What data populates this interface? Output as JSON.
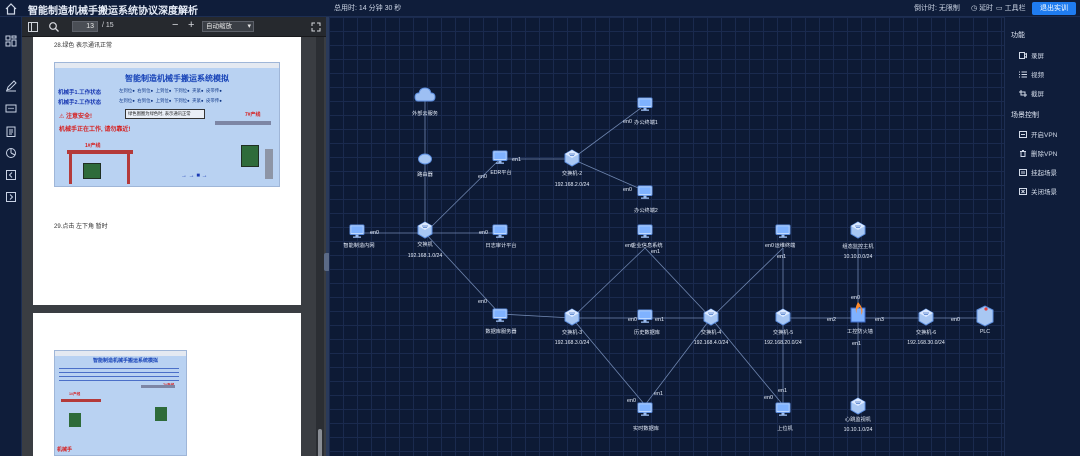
{
  "app": {
    "title": "智能制造机械手搬运系统协议深度解析",
    "total_time": "总用时: 14 分钟 30 秒",
    "countdown": "倒计时: 无限制",
    "delay_label": "延时",
    "toolbar_label": "工具栏",
    "exit_label": "退出实训"
  },
  "rail": {
    "icons": [
      "grid-icon",
      "edit-icon",
      "chat-icon",
      "clipboard-icon",
      "chart-icon",
      "back-icon",
      "exit-icon"
    ]
  },
  "viewer": {
    "page_current": "13",
    "page_total": "/ 15",
    "zoom_out": "−",
    "zoom_in": "+",
    "zoom_mode": "自动缩放",
    "page1": {
      "caption_top": "28.绿色 表示通讯正常",
      "caption_bottom": "29.点击 左下角 暂时",
      "shot": {
        "title": "智能制造机械手搬运系统模拟",
        "row1": "机械手1.工作状态",
        "row2": "机械手2.工作状态",
        "row1_items": [
          "左到位",
          "右到位",
          "上到位",
          "下到位",
          "夹紧",
          "皮带传"
        ],
        "row2_items": [
          "左到位",
          "右到位",
          "上到位",
          "下到位",
          "夹紧",
          "皮带传"
        ],
        "safety": "注意安全!",
        "working": "机械手正在工作, 请勿靠近!",
        "status_hint": "绿色图圈为绿色时, 表示通讯正常",
        "line1": "1#产线",
        "line2": "7#产线"
      }
    },
    "page2": {
      "shot": {
        "title": "智能制造机械手搬运系统模拟",
        "line1": "1#产线",
        "line2": "7#产线",
        "bottom": "机械手"
      }
    }
  },
  "network": {
    "nodes": {
      "cloud": "外部云服务",
      "router": "路由器",
      "mfg_net": "智能制造内网",
      "switch1": "交换机",
      "switch1_ip": "192.168.1.0/24",
      "edr": "EDR平台",
      "log_audit": "日志审计平台",
      "switch2": "交换机-2",
      "switch2_ip": "192.168.2.0/24",
      "office1": "办公终端1",
      "office2": "办公终端2",
      "enterprise": "企业信息系统",
      "ops": "运维终端",
      "scada": "组态监控主机",
      "scada_ip": "10.10.0.0/24",
      "db_server": "数据库服务器",
      "switch3": "交换机-3",
      "switch3_ip": "192.168.3.0/24",
      "hist_db": "历史数据库",
      "switch4": "交换机-4",
      "switch4_ip": "192.168.4.0/24",
      "switch5": "交换机-5",
      "switch5_ip": "192.168.20.0/24",
      "firewall": "工控防火墙",
      "switch6": "交换机-6",
      "switch6_ip": "192.168.30.0/24",
      "plc": "PLC",
      "realtime_db": "实时数据库",
      "upper": "上位机",
      "hmi": "心跳监视机",
      "hmi_ip": "10.10.1.0/24"
    },
    "ports": {
      "p_mfg": "en0",
      "p_edr_a": "en0",
      "p_edr_b": "en1",
      "p_log": "en0",
      "p_off1": "en0",
      "p_off2": "en0",
      "p_ent_a": "en0",
      "p_ent_b": "en1",
      "p_ops_a": "en0",
      "p_ops_b": "en1",
      "p_db": "en0",
      "p_hist_a": "en0",
      "p_hist_b": "en1",
      "p_fw_top": "en0",
      "p_fw_left": "en2",
      "p_fw_right": "en3",
      "p_fw_bottom": "en1",
      "p_plc": "en0",
      "p_rt_a": "en0",
      "p_rt_b": "en1",
      "p_up_a": "en1",
      "p_up_b": "en0"
    }
  },
  "panel": {
    "functions_title": "功能",
    "functions": [
      "录屏",
      "视频",
      "截屏"
    ],
    "function_icons": [
      "record-icon",
      "list-icon",
      "crop-icon"
    ],
    "scene_title": "场景控制",
    "scene": [
      "开启VPN",
      "删除VPN",
      "挂起场景",
      "关闭场景"
    ],
    "scene_icons": [
      "vpn-icon",
      "trash-icon",
      "pause-icon",
      "close-scene-icon"
    ]
  },
  "colors": {
    "canvas_bg": "#0d1a35",
    "accent": "#1f7cf0",
    "link": "#6f86b0"
  }
}
